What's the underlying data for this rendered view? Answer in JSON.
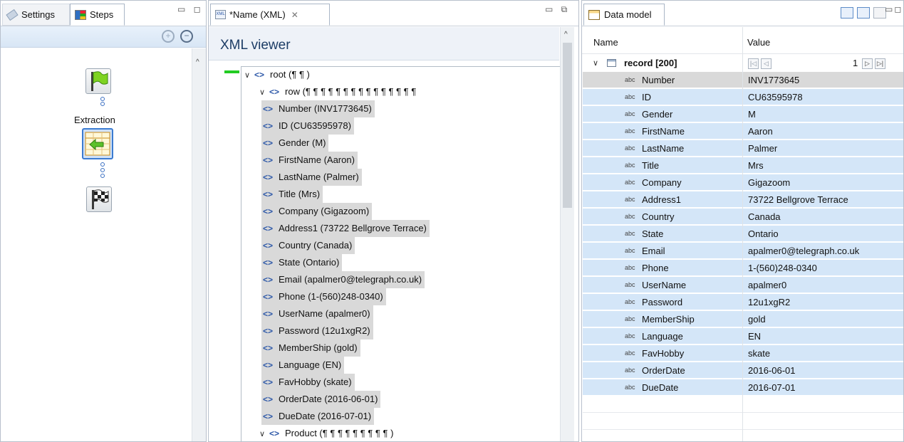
{
  "left_panel": {
    "tabs": [
      {
        "label": "Settings",
        "icon": "tag-icon"
      },
      {
        "label": "Steps",
        "icon": "steps-icon"
      }
    ],
    "steps": [
      {
        "label": "",
        "icon": "green-flag-icon"
      },
      {
        "label": "Extraction",
        "icon": "extraction-table-icon"
      },
      {
        "label": "",
        "icon": "checkered-flag-icon"
      }
    ]
  },
  "middle_panel": {
    "tab_label": "*Name (XML)",
    "header_title": "XML viewer",
    "tree": [
      {
        "level": 0,
        "text": "root  (¶ ¶ )",
        "expanded": true,
        "selected": false
      },
      {
        "level": 1,
        "text": "row  (¶   ¶   ¶   ¶   ¶   ¶   ¶   ¶   ¶   ¶   ¶   ¶   ¶   ¶   ¶",
        "expanded": true,
        "selected": false
      },
      {
        "level": 2,
        "text": "Number  (INV1773645)",
        "selected": true
      },
      {
        "level": 2,
        "text": "ID  (CU63595978)",
        "selected": true
      },
      {
        "level": 2,
        "text": "Gender  (M)",
        "selected": true
      },
      {
        "level": 2,
        "text": "FirstName  (Aaron)",
        "selected": true
      },
      {
        "level": 2,
        "text": "LastName  (Palmer)",
        "selected": true
      },
      {
        "level": 2,
        "text": "Title  (Mrs)",
        "selected": true
      },
      {
        "level": 2,
        "text": "Company  (Gigazoom)",
        "selected": true
      },
      {
        "level": 2,
        "text": "Address1  (73722 Bellgrove Terrace)",
        "selected": true
      },
      {
        "level": 2,
        "text": "Country  (Canada)",
        "selected": true
      },
      {
        "level": 2,
        "text": "State  (Ontario)",
        "selected": true
      },
      {
        "level": 2,
        "text": "Email  (apalmer0@telegraph.co.uk)",
        "selected": true
      },
      {
        "level": 2,
        "text": "Phone  (1-(560)248-0340)",
        "selected": true
      },
      {
        "level": 2,
        "text": "UserName  (apalmer0)",
        "selected": true
      },
      {
        "level": 2,
        "text": "Password  (12u1xgR2)",
        "selected": true
      },
      {
        "level": 2,
        "text": "MemberShip  (gold)",
        "selected": true
      },
      {
        "level": 2,
        "text": "Language  (EN)",
        "selected": true
      },
      {
        "level": 2,
        "text": "FavHobby  (skate)",
        "selected": true
      },
      {
        "level": 2,
        "text": "OrderDate  (2016-06-01)",
        "selected": true
      },
      {
        "level": 2,
        "text": "DueDate  (2016-07-01)",
        "selected": true
      },
      {
        "level": 1,
        "text": "Product  (¶    ¶    ¶    ¶    ¶    ¶    ¶    ¶    ¶  )",
        "expanded": true,
        "selected": false
      }
    ]
  },
  "right_panel": {
    "tab_label": "Data model",
    "columns": {
      "name": "Name",
      "value": "Value"
    },
    "record": {
      "label": "record [200]",
      "page": "1"
    },
    "fields": [
      {
        "name": "Number",
        "value": "INV1773645"
      },
      {
        "name": "ID",
        "value": "CU63595978"
      },
      {
        "name": "Gender",
        "value": "M"
      },
      {
        "name": "FirstName",
        "value": "Aaron"
      },
      {
        "name": "LastName",
        "value": "Palmer"
      },
      {
        "name": "Title",
        "value": "Mrs"
      },
      {
        "name": "Company",
        "value": "Gigazoom"
      },
      {
        "name": "Address1",
        "value": "73722 Bellgrove Terrace"
      },
      {
        "name": "Country",
        "value": "Canada"
      },
      {
        "name": "State",
        "value": "Ontario"
      },
      {
        "name": "Email",
        "value": "apalmer0@telegraph.co.uk"
      },
      {
        "name": "Phone",
        "value": "1-(560)248-0340"
      },
      {
        "name": "UserName",
        "value": "apalmer0"
      },
      {
        "name": "Password",
        "value": "12u1xgR2"
      },
      {
        "name": "MemberShip",
        "value": "gold"
      },
      {
        "name": "Language",
        "value": "EN"
      },
      {
        "name": "FavHobby",
        "value": "skate"
      },
      {
        "name": "OrderDate",
        "value": "2016-06-01"
      },
      {
        "name": "DueDate",
        "value": "2016-07-01"
      }
    ],
    "type_badge": "abc"
  },
  "colors": {
    "accent": "#2d58a8",
    "selection": "#d4e6f8",
    "selected_gray": "#d9d9d9",
    "green_marker": "#22cc22"
  }
}
